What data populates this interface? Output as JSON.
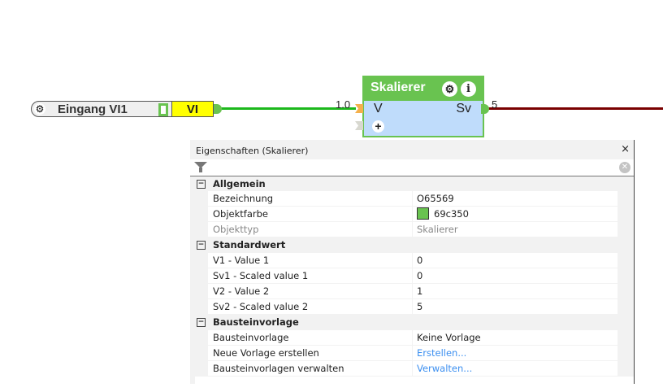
{
  "input_node": {
    "label": "Eingang VI1",
    "type": "VI"
  },
  "block": {
    "title": "Skalierer",
    "input": "V",
    "output": "Sv",
    "input_value": "1.0",
    "output_value": "5"
  },
  "colors": {
    "block": "#69c350",
    "wire_in": "#1cb81c",
    "wire_out": "#7a0000",
    "input_type_bg": "#ffff00"
  },
  "panel": {
    "title": "Eigenschaften (Skalierer)",
    "close": "×",
    "categories": [
      {
        "label": "Allgemein",
        "rows": [
          {
            "name": "Bezeichnung",
            "value": "O65569"
          },
          {
            "name": "Objektfarbe",
            "value": "69c350"
          },
          {
            "name": "Objekttyp",
            "value": "Skalierer"
          }
        ]
      },
      {
        "label": "Standardwert",
        "rows": [
          {
            "name": "V1 - Value 1",
            "value": "0"
          },
          {
            "name": "Sv1 - Scaled value 1",
            "value": "0"
          },
          {
            "name": "V2 - Value 2",
            "value": "1"
          },
          {
            "name": "Sv2 - Scaled value 2",
            "value": "5"
          }
        ]
      },
      {
        "label": "Bausteinvorlage",
        "rows": [
          {
            "name": "Bausteinvorlage",
            "value": "Keine Vorlage"
          },
          {
            "name": "Neue Vorlage erstellen",
            "value": "Erstellen..."
          },
          {
            "name": "Bausteinvorlagen verwalten",
            "value": "Verwalten..."
          }
        ]
      }
    ]
  }
}
